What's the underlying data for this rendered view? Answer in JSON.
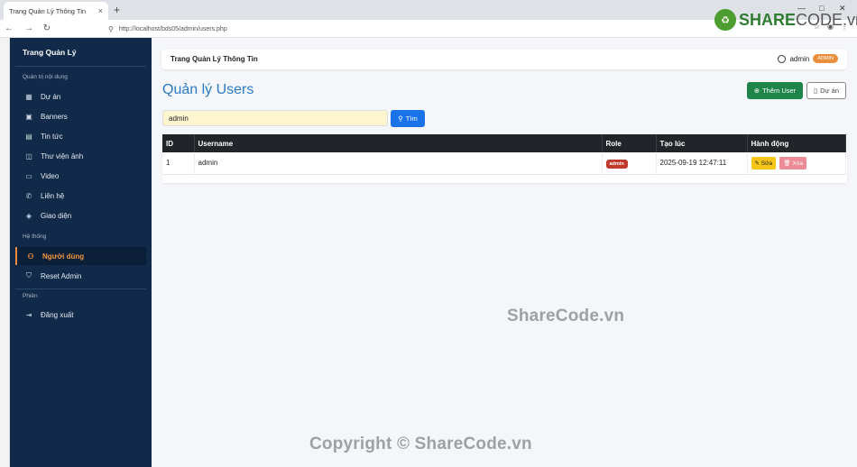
{
  "browser": {
    "tab_title": "Trang Quản Lý Thông Tin",
    "tab_close": "×",
    "new_tab": "+",
    "url": "http://localhost/bds05/admin/users.php",
    "back": "←",
    "forward": "→",
    "reload": "↻"
  },
  "sidebar": {
    "brand": "Trang Quản Lý",
    "sections": [
      {
        "label": "Quản trị nội dung"
      },
      {
        "label": "Hệ thống"
      },
      {
        "label": "Phiên"
      }
    ],
    "items": [
      {
        "label": "Dự án",
        "icon": "building-icon"
      },
      {
        "label": "Banners",
        "icon": "image-icon"
      },
      {
        "label": "Tin tức",
        "icon": "newspaper-icon"
      },
      {
        "label": "Thư viện ảnh",
        "icon": "gallery-icon"
      },
      {
        "label": "Video",
        "icon": "video-icon"
      },
      {
        "label": "Liên hệ",
        "icon": "phone-icon"
      },
      {
        "label": "Giao diện",
        "icon": "palette-icon"
      },
      {
        "label": "Người dùng",
        "icon": "users-icon"
      },
      {
        "label": "Reset Admin",
        "icon": "shield-icon"
      },
      {
        "label": "Đăng xuất",
        "icon": "logout-icon"
      }
    ],
    "active_color": "#f5963f"
  },
  "header": {
    "title": "Trang Quản Lý Thông Tin",
    "username": "admin",
    "role_badge": "ADMIN"
  },
  "main": {
    "page_title": "Quản lý Users",
    "add_button": "Thêm User",
    "project_button": "Dự án",
    "search_value": "admin",
    "search_button": "Tìm",
    "table": {
      "columns": [
        "ID",
        "Username",
        "Role",
        "Tạo lúc",
        "Hành động"
      ],
      "rows": [
        {
          "id": "1",
          "username": "admin",
          "role": "admin",
          "created": "2025-09-19 12:47:11",
          "edit": "Sửa",
          "delete": "Xóa"
        }
      ]
    }
  },
  "watermarks": {
    "logo_mark": "♻",
    "logo_share": "SHARE",
    "logo_code": "CODE",
    "logo_vn": ".vn",
    "center": "ShareCode.vn",
    "bottom": "Copyright © ShareCode.vn"
  },
  "colors": {
    "sidebar_bg": "#112a49",
    "primary": "#1a73e8",
    "success": "#1e8449",
    "title_blue": "#2a7bc4"
  }
}
